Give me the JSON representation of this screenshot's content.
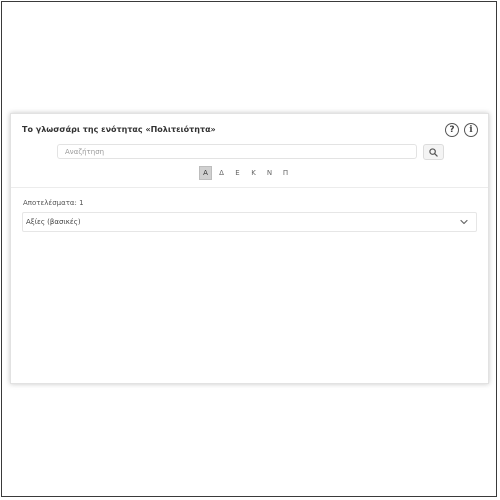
{
  "glossary": {
    "title": "Το γλωσσάρι της ενότητας «Πολιτειότητα»",
    "help_icon": "question-circle-icon",
    "info_icon": "info-circle-icon",
    "help_glyph": "?",
    "info_glyph": "i",
    "search": {
      "placeholder": "Αναζήτηση",
      "value": "",
      "button_icon": "search-icon"
    },
    "letters": [
      {
        "label": "Α",
        "active": true
      },
      {
        "label": "Δ",
        "active": false
      },
      {
        "label": "Ε",
        "active": false
      },
      {
        "label": "Κ",
        "active": false
      },
      {
        "label": "Ν",
        "active": false
      },
      {
        "label": "Π",
        "active": false
      }
    ],
    "results_label": "Αποτελέσματα: 1",
    "results": [
      {
        "term": "Αξίες (βασικές)",
        "icon": "chevron-down-icon"
      }
    ],
    "colors": {
      "active_letter_bg": "#d0d0d0",
      "border": "#e6e6e6",
      "text": "#333333"
    }
  }
}
